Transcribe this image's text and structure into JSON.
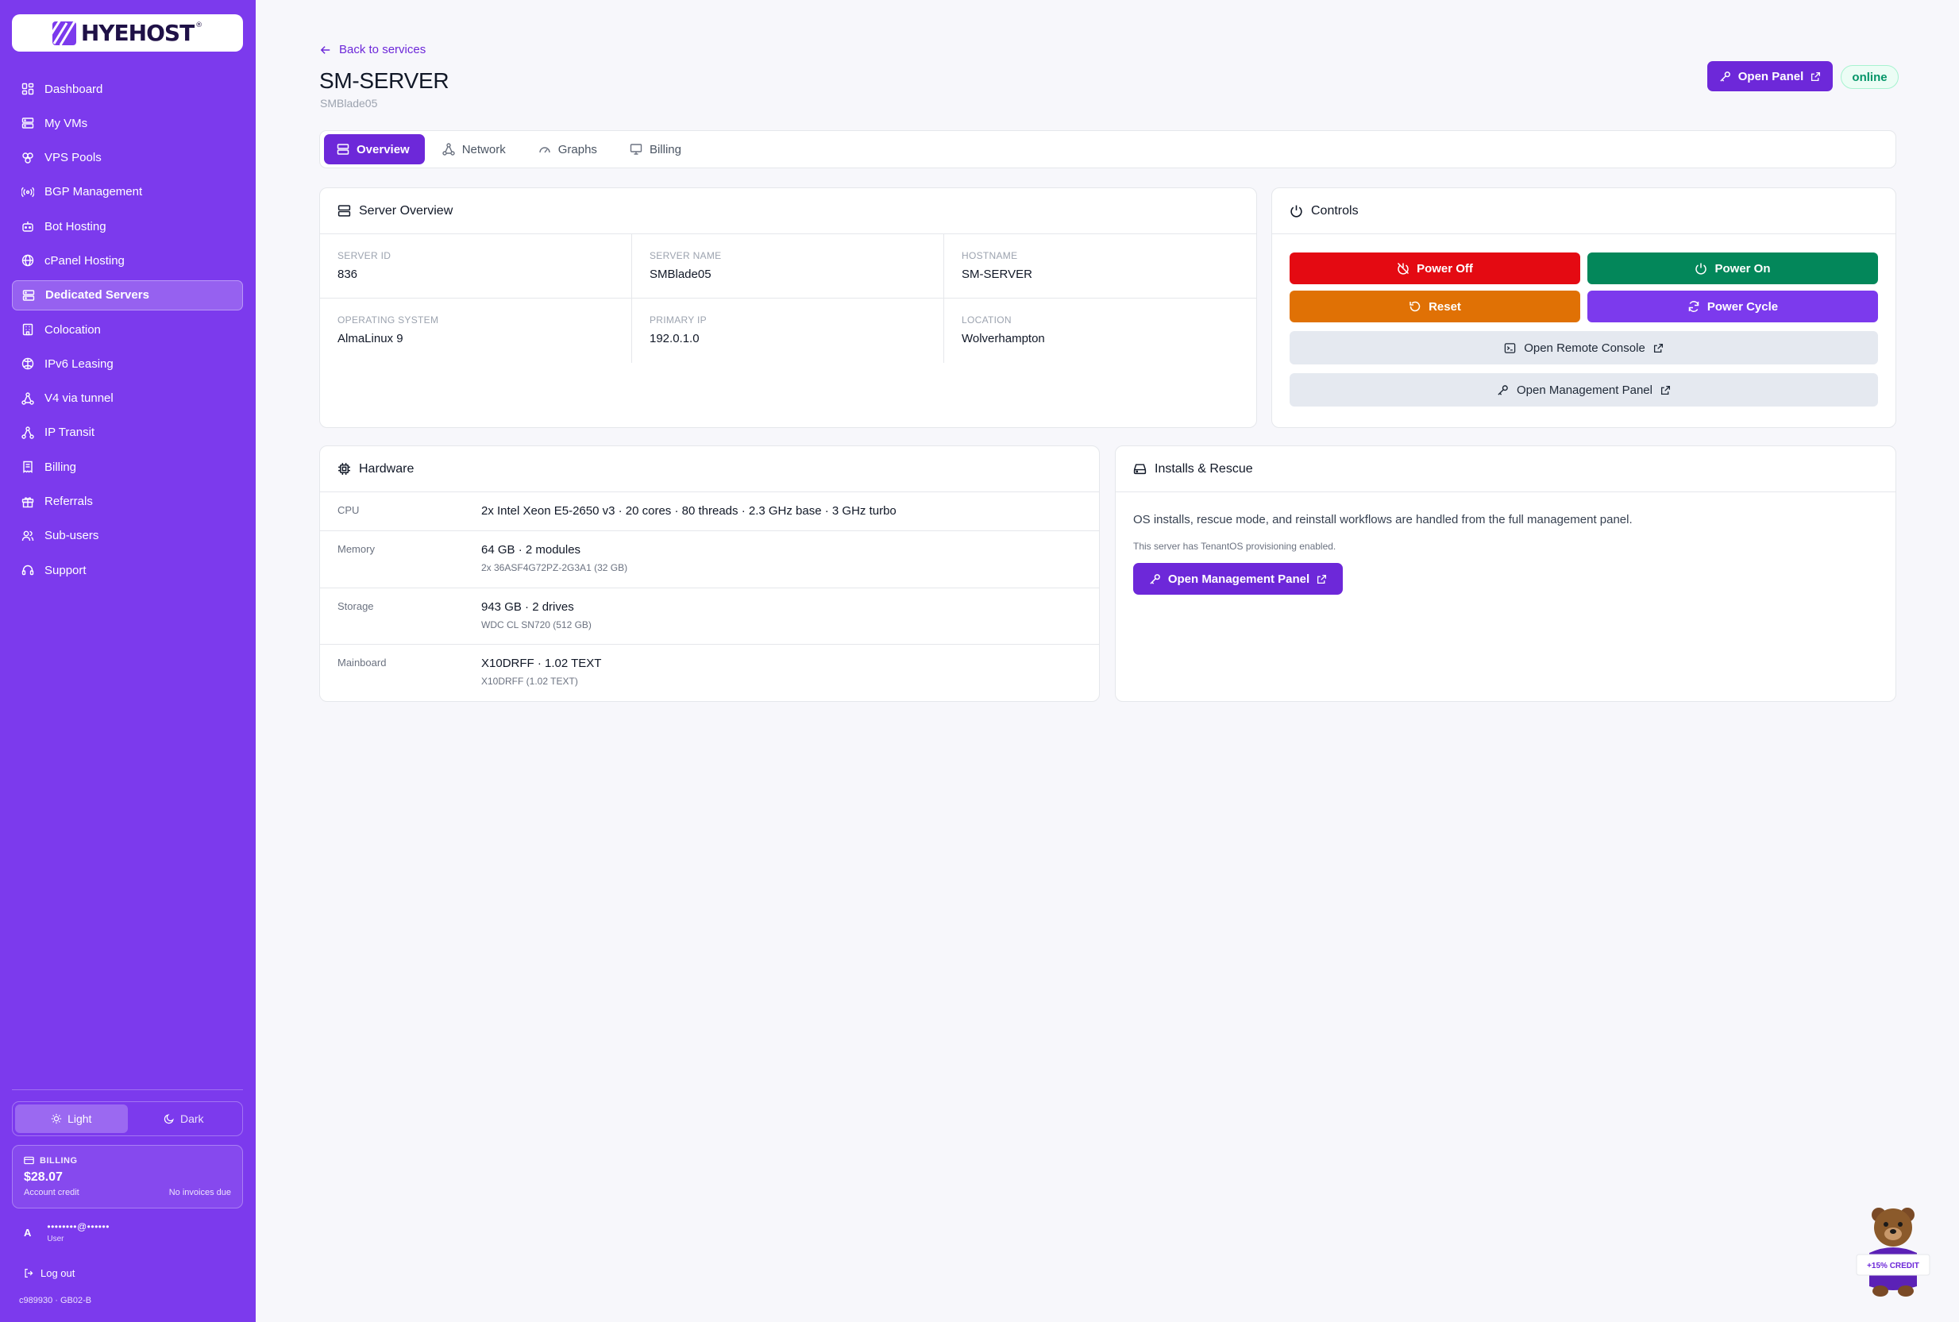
{
  "brand": {
    "name": "HYEHOST",
    "trademark": "®"
  },
  "sidebar": {
    "items": [
      {
        "label": "Dashboard",
        "icon": "dashboard-icon"
      },
      {
        "label": "My VMs",
        "icon": "server-icon"
      },
      {
        "label": "VPS Pools",
        "icon": "pool-icon"
      },
      {
        "label": "BGP Management",
        "icon": "radio-icon"
      },
      {
        "label": "Bot Hosting",
        "icon": "bot-icon"
      },
      {
        "label": "cPanel Hosting",
        "icon": "globe-icon"
      },
      {
        "label": "Dedicated Servers",
        "icon": "server-icon",
        "active": true
      },
      {
        "label": "Colocation",
        "icon": "building-icon"
      },
      {
        "label": "IPv6 Leasing",
        "icon": "globe-icon"
      },
      {
        "label": "V4 via tunnel",
        "icon": "network-icon"
      },
      {
        "label": "IP Transit",
        "icon": "network-icon"
      },
      {
        "label": "Billing",
        "icon": "receipt-icon"
      },
      {
        "label": "Referrals",
        "icon": "gift-icon"
      },
      {
        "label": "Sub-users",
        "icon": "users-icon"
      },
      {
        "label": "Support",
        "icon": "headset-icon"
      }
    ],
    "theme": {
      "light": "Light",
      "dark": "Dark",
      "selected": "light"
    },
    "billing": {
      "heading": "BILLING",
      "amount": "$28.07",
      "caption": "Account credit",
      "invoices": "No invoices due"
    },
    "user": {
      "initial": "A",
      "email": "••••••••@••••••",
      "role": "User"
    },
    "logout": "Log out",
    "footer": "c989930 · GB02-B"
  },
  "header": {
    "back": "Back to services",
    "title": "SM-SERVER",
    "subtitle": "SMBlade05",
    "open_panel": "Open Panel",
    "status": "online"
  },
  "tabs": [
    {
      "label": "Overview",
      "active": true
    },
    {
      "label": "Network"
    },
    {
      "label": "Graphs"
    },
    {
      "label": "Billing"
    }
  ],
  "overview": {
    "heading": "Server Overview",
    "fields": [
      {
        "label": "SERVER ID",
        "value": "836"
      },
      {
        "label": "SERVER NAME",
        "value": "SMBlade05"
      },
      {
        "label": "HOSTNAME",
        "value": "SM-SERVER"
      },
      {
        "label": "OPERATING SYSTEM",
        "value": "AlmaLinux 9"
      },
      {
        "label": "PRIMARY IP",
        "value": "192.0.1.0"
      },
      {
        "label": "LOCATION",
        "value": "Wolverhampton"
      }
    ]
  },
  "controls": {
    "heading": "Controls",
    "power_off": "Power Off",
    "power_on": "Power On",
    "reset": "Reset",
    "power_cycle": "Power Cycle",
    "remote_console": "Open Remote Console",
    "management_panel": "Open Management Panel"
  },
  "hardware": {
    "heading": "Hardware",
    "rows": [
      {
        "label": "CPU",
        "value": "2x Intel Xeon E5-2650 v3 · 20 cores · 80 threads · 2.3 GHz base · 3 GHz turbo",
        "detail": ""
      },
      {
        "label": "Memory",
        "value": "64 GB · 2 modules",
        "detail": "2x 36ASF4G72PZ-2G3A1 (32 GB)"
      },
      {
        "label": "Storage",
        "value": "943 GB · 2 drives",
        "detail": "WDC CL SN720 (512 GB)"
      },
      {
        "label": "Mainboard",
        "value": "X10DRFF · 1.02 TEXT",
        "detail": "X10DRFF (1.02 TEXT)"
      }
    ]
  },
  "installs": {
    "heading": "Installs & Rescue",
    "text": "OS installs, rescue mode, and reinstall workflows are handled from the full management panel.",
    "note": "This server has TenantOS provisioning enabled.",
    "button": "Open Management Panel"
  },
  "mascot": {
    "sign": "+15% CREDIT"
  },
  "colors": {
    "accent": "#7c3aed",
    "accent_dark": "#6d28d9",
    "power_off": "#e40a12",
    "power_on": "#03875a",
    "reset": "#e07105",
    "power_cycle": "#7c3aed",
    "online": "#059669"
  }
}
